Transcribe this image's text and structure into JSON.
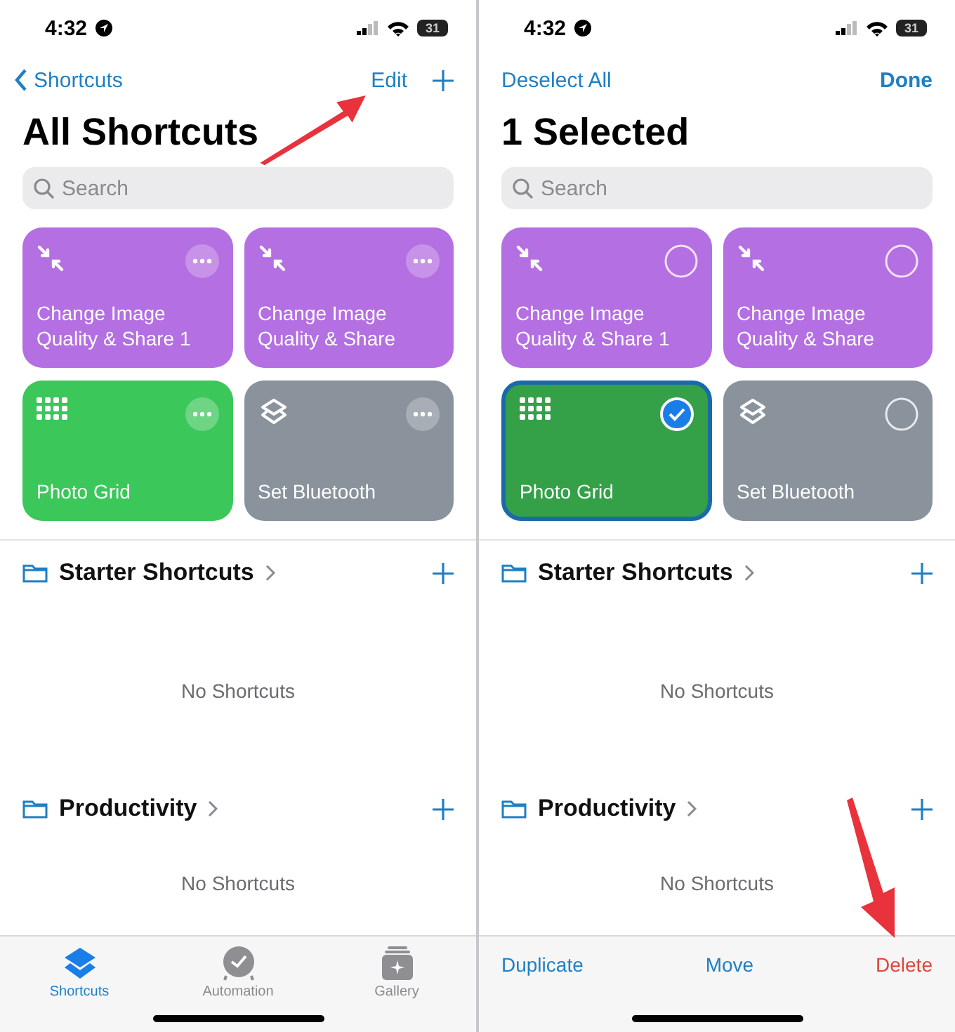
{
  "panels": [
    {
      "status_bar": {
        "time": "4:32",
        "battery": "31"
      },
      "nav": {
        "back": "Shortcuts",
        "actions": [
          {
            "kind": "text",
            "label": "Edit"
          },
          {
            "kind": "plus"
          }
        ]
      },
      "annotations": [
        {
          "kind": "arrow-up-right"
        }
      ],
      "title": "All Shortcuts",
      "search": {
        "placeholder": "Search"
      },
      "kind": "browse",
      "shortcuts": [
        {
          "name": "Change Image Quality & Share 1",
          "color": "#b46fe2",
          "kind": "compress"
        },
        {
          "name": "Change Image Quality & Share",
          "color": "#b46fe2",
          "kind": "compress"
        },
        {
          "name": "Photo Grid",
          "color": "#3cc75a",
          "kind": "grid"
        },
        {
          "name": "Set Bluetooth",
          "color": "#8a939c",
          "kind": "layers"
        }
      ],
      "folders": [
        {
          "name": "Starter Shortcuts",
          "empty_text": "No Shortcuts"
        },
        {
          "name": "Productivity",
          "empty_text": "No Shortcuts"
        }
      ],
      "bottom_bar": {
        "kind": "tabs",
        "items": [
          {
            "label": "Shortcuts",
            "kind": "layers",
            "selected": true
          },
          {
            "label": "Automation",
            "kind": "clock",
            "selected": false
          },
          {
            "label": "Gallery",
            "kind": "gallery",
            "selected": false
          }
        ]
      }
    },
    {
      "status_bar": {
        "time": "4:32",
        "battery": "31"
      },
      "nav": {
        "deselect": "Deselect All",
        "actions": [
          {
            "kind": "text",
            "label": "Done"
          }
        ]
      },
      "annotations": [
        {
          "kind": "arrow-down"
        }
      ],
      "title": "1 Selected",
      "search": {
        "placeholder": "Search"
      },
      "kind": "select",
      "shortcuts": [
        {
          "name": "Change Image Quality & Share 1",
          "color": "#b46fe2",
          "kind": "compress",
          "selected": false
        },
        {
          "name": "Change Image Quality & Share",
          "color": "#b46fe2",
          "kind": "compress",
          "selected": false
        },
        {
          "name": "Photo Grid",
          "color": "#34a048",
          "kind": "grid",
          "selected": true
        },
        {
          "name": "Set Bluetooth",
          "color": "#8a939c",
          "kind": "layers",
          "selected": false
        }
      ],
      "folders": [
        {
          "name": "Starter Shortcuts",
          "empty_text": "No Shortcuts"
        },
        {
          "name": "Productivity",
          "empty_text": "No Shortcuts"
        }
      ],
      "bottom_bar": {
        "kind": "actions",
        "items": [
          {
            "label": "Duplicate",
            "kind": "normal"
          },
          {
            "label": "Move",
            "kind": "normal"
          },
          {
            "label": "Delete",
            "kind": "destructive"
          }
        ]
      }
    }
  ]
}
